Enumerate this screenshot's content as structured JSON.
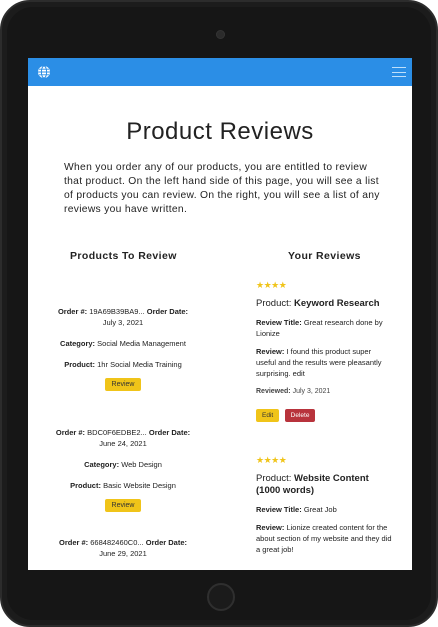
{
  "page": {
    "title": "Product Reviews",
    "intro": "When you order any of our products, you are entitled to review that product. On the left hand side of this page, you will see a list of products you can review. On the right, you will see a list of any reviews you have written."
  },
  "left": {
    "heading": "Products To Review",
    "orders": [
      {
        "order_label": "Order #:",
        "order_no": "19A69B39BA9...",
        "date_label": "Order Date:",
        "date": "July 3, 2021",
        "category_label": "Category:",
        "category": "Social Media Management",
        "product_label": "Product:",
        "product": "1hr Social Media Training",
        "button": "Review"
      },
      {
        "order_label": "Order #:",
        "order_no": "BDC0F6EDBE2...",
        "date_label": "Order Date:",
        "date": "June 24, 2021",
        "category_label": "Category:",
        "category": "Web Design",
        "product_label": "Product:",
        "product": "Basic Website Design",
        "button": "Review"
      },
      {
        "order_label": "Order #:",
        "order_no": "668482460C0...",
        "date_label": "Order Date:",
        "date": "June 29, 2021"
      }
    ]
  },
  "right": {
    "heading": "Your Reviews",
    "reviews": [
      {
        "stars": "★★★★",
        "product_label": "Product:",
        "product": "Keyword Research",
        "title_label": "Review Title:",
        "title": "Great research done by Lionize",
        "review_label": "Review:",
        "review": "I found this product super useful and the results were pleasantly surprising. edit",
        "reviewed_label": "Reviewed:",
        "reviewed": "July 3, 2021",
        "edit": "Edit",
        "delete": "Delete"
      },
      {
        "stars": "★★★★",
        "product_label": "Product:",
        "product": "Website Content (1000 words)",
        "title_label": "Review Title:",
        "title": "Great Job",
        "review_label": "Review:",
        "review": "Lionize created content for the about section of my website and they did a great job!"
      }
    ]
  },
  "icons": {
    "brand": "globe-icon",
    "menu": "hamburger-menu-icon"
  },
  "colors": {
    "navbar": "#2b8ee6",
    "review_button": "#f0c419",
    "delete_button": "#b8333c",
    "stars": "#f0c419"
  }
}
